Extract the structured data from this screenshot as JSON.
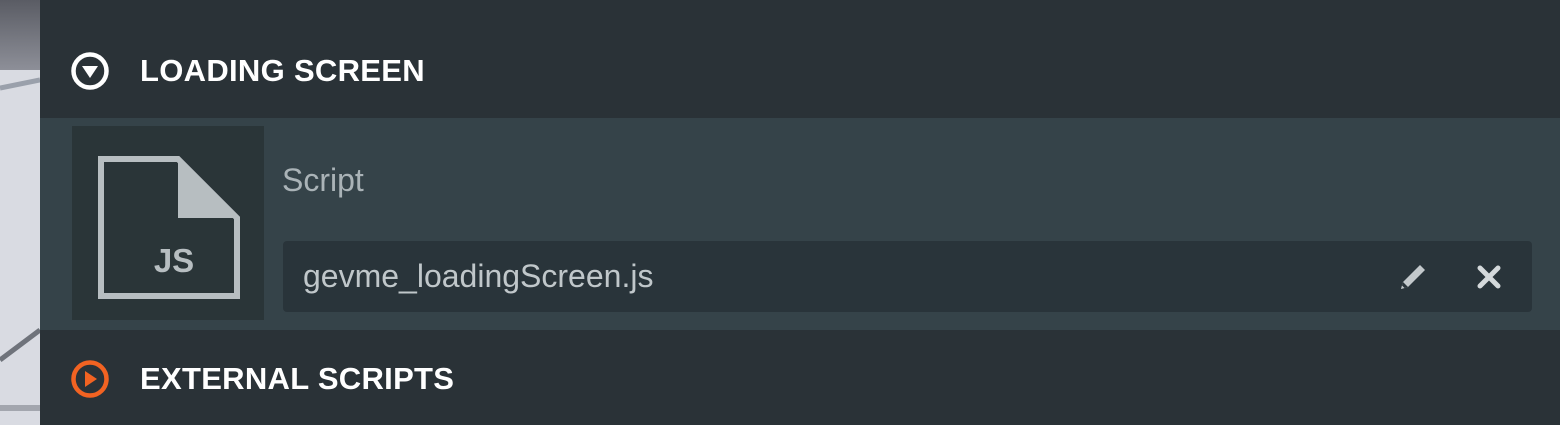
{
  "sections": [
    {
      "title": "LOADING SCREEN",
      "state": "expanded",
      "icon": "collapse-down-icon",
      "icon_color": "#ffffff"
    },
    {
      "title": "EXTERNAL SCRIPTS",
      "state": "collapsed",
      "icon": "expand-right-icon",
      "icon_color": "#f26322"
    }
  ],
  "loading_screen": {
    "thumbnail": {
      "icon": "js-file-icon",
      "label": "JS"
    },
    "field_label": "Script",
    "field_value": "gevme_loadingScreen.js",
    "actions": [
      {
        "icon": "pencil-icon",
        "name": "edit"
      },
      {
        "icon": "close-icon",
        "name": "remove"
      }
    ]
  },
  "colors": {
    "panel_bg": "#2a3237",
    "body_bg": "#354349",
    "accent": "#f26322"
  }
}
